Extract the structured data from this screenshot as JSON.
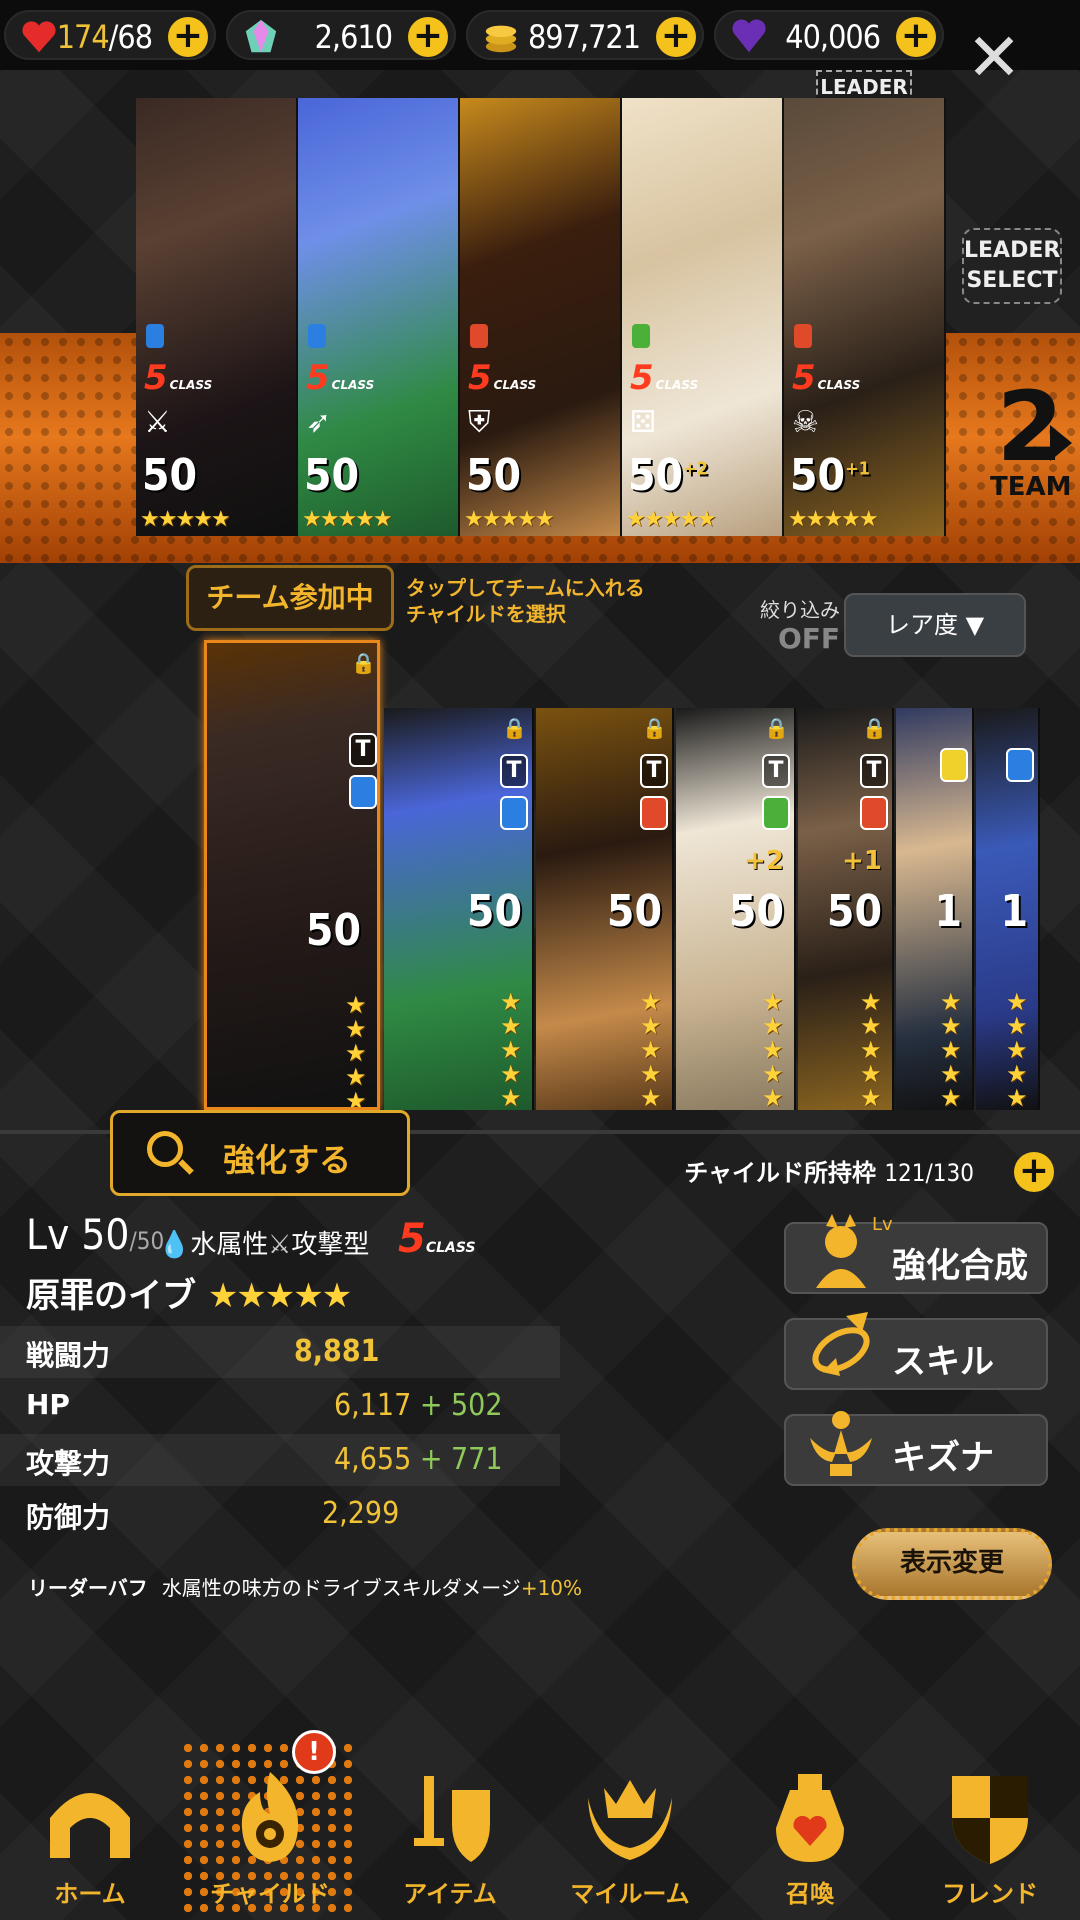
{
  "resources": {
    "stamina": {
      "current": "174",
      "max": "/68"
    },
    "gems": "2,610",
    "gold": "897,721",
    "hearts": "40,006"
  },
  "team": {
    "leader_tag": "LEADER",
    "leader_select": "LEADER SELECT",
    "team_number": "2",
    "team_word": "TEAM",
    "members": [
      {
        "class": "5",
        "class_word": "CLASS",
        "level": "50",
        "plus": "",
        "element_color": "#2a7fe0",
        "type_icon": "swords-icon"
      },
      {
        "class": "5",
        "class_word": "CLASS",
        "level": "50",
        "plus": "",
        "element_color": "#2a7fe0",
        "type_icon": "wing-icon"
      },
      {
        "class": "5",
        "class_word": "CLASS",
        "level": "50",
        "plus": "",
        "element_color": "#e04a2a",
        "type_icon": "shield-icon"
      },
      {
        "class": "5",
        "class_word": "CLASS",
        "level": "50",
        "plus": "+2",
        "element_color": "#4ab03a",
        "type_icon": "dice-icon"
      },
      {
        "class": "5",
        "class_word": "CLASS",
        "level": "50",
        "plus": "+1",
        "element_color": "#e04a2a",
        "type_icon": "skull-icon"
      }
    ],
    "stars": "★★★★★"
  },
  "status": {
    "in_team": "チーム参加中",
    "hint_line1": "タップしてチームに入れる",
    "hint_line2": "チャイルドを選択",
    "filter_label": "絞り込み",
    "filter_value": "OFF",
    "sort_label": "レア度 ▼"
  },
  "children": [
    {
      "level": "50",
      "plus": ""
    },
    {
      "level": "50",
      "plus": ""
    },
    {
      "level": "50",
      "plus": ""
    },
    {
      "level": "50",
      "plus": "+2"
    },
    {
      "level": "50",
      "plus": "+1"
    },
    {
      "level": "1",
      "plus": ""
    },
    {
      "level": "1",
      "plus": ""
    }
  ],
  "t_badge": "T",
  "enhance_button": "強化する",
  "owned": {
    "label": "チャイルド所持枠",
    "count": "121/130"
  },
  "selected": {
    "lv_prefix": "Lv 50",
    "lv_max": "/50",
    "attribute": "水属性",
    "attack_type": "攻撃型",
    "class_num": "5",
    "class_word": "CLASS",
    "name": "原罪のイブ",
    "stars": "★★★★★"
  },
  "stats": [
    {
      "key": "戦闘力",
      "value": "8,881",
      "bonus": ""
    },
    {
      "key": "HP",
      "value": "6,117",
      "bonus": " + 502"
    },
    {
      "key": "攻撃力",
      "value": "4,655",
      "bonus": " + 771"
    },
    {
      "key": "防御力",
      "value": "2,299",
      "bonus": ""
    }
  ],
  "leader_buff": {
    "key": "リーダーバフ",
    "text": "水属性の味方のドライブスキルダメージ",
    "percent": "+10%"
  },
  "side_buttons": {
    "fusion": "強化合成",
    "fusion_sup": "Lv",
    "skill": "スキル",
    "kizuna": "キズナ",
    "display": "表示変更"
  },
  "nav": {
    "home": "ホーム",
    "child": "チャイルド",
    "item": "アイテム",
    "myroom": "マイルーム",
    "summon": "召喚",
    "friend": "フレンド",
    "alert": "!"
  }
}
